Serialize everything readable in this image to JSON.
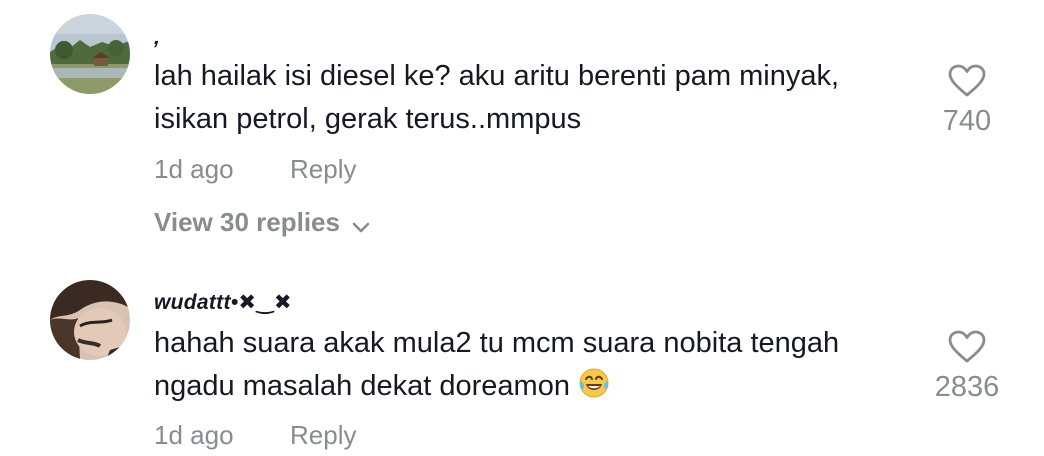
{
  "comments": [
    {
      "username": ",",
      "text": "lah hailak isi diesel ke? aku aritu berenti pam minyak, isikan petrol, gerak terus..mmpus",
      "time": "1d ago",
      "reply_label": "Reply",
      "likes": "740",
      "view_replies_label": "View 30 replies"
    },
    {
      "username": "wudattt•✖‿✖",
      "text": "hahah suara akak mula2 tu mcm suara nobita tengah ngadu masalah dekat doreamon",
      "emoji": "face-with-tears-of-joy-emoji",
      "time": "1d ago",
      "reply_label": "Reply",
      "likes": "2836"
    }
  ],
  "colors": {
    "text_primary": "#161823",
    "text_secondary": "#8a8b91",
    "background": "#ffffff"
  },
  "icons": {
    "like": "heart-outline-icon",
    "expand": "chevron-down-icon"
  }
}
